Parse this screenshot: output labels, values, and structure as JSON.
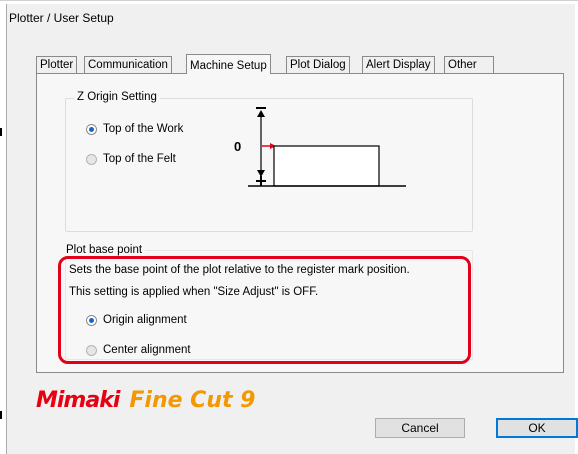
{
  "window": {
    "title": "Plotter / User Setup"
  },
  "tabs": [
    {
      "label": "Plotter"
    },
    {
      "label": "Communication"
    },
    {
      "label": "Machine Setup"
    },
    {
      "label": "Plot Dialog"
    },
    {
      "label": "Alert Display"
    },
    {
      "label": "Other"
    }
  ],
  "active_tab": "Machine Setup",
  "z_origin": {
    "legend": "Z Origin Setting",
    "options": [
      {
        "label": "Top of the Work",
        "selected": true
      },
      {
        "label": "Top of the Felt",
        "selected": false
      }
    ],
    "diagram_zero": "0"
  },
  "plot_base": {
    "legend": "Plot base point",
    "desc1": "Sets the base point of the plot relative to the register mark position.",
    "desc2": "This setting is applied when \"Size Adjust\" is OFF.",
    "options": [
      {
        "label": "Origin alignment",
        "selected": true
      },
      {
        "label": "Center alignment",
        "selected": false
      }
    ]
  },
  "branding": {
    "brand": "Mimaki",
    "product": "Fine Cut 9"
  },
  "buttons": {
    "cancel": "Cancel",
    "ok": "OK"
  },
  "colors": {
    "highlight": "#e2001a",
    "brand_red": "#e60012",
    "product_orange": "#f39800",
    "arrow_red": "#e2001a"
  }
}
